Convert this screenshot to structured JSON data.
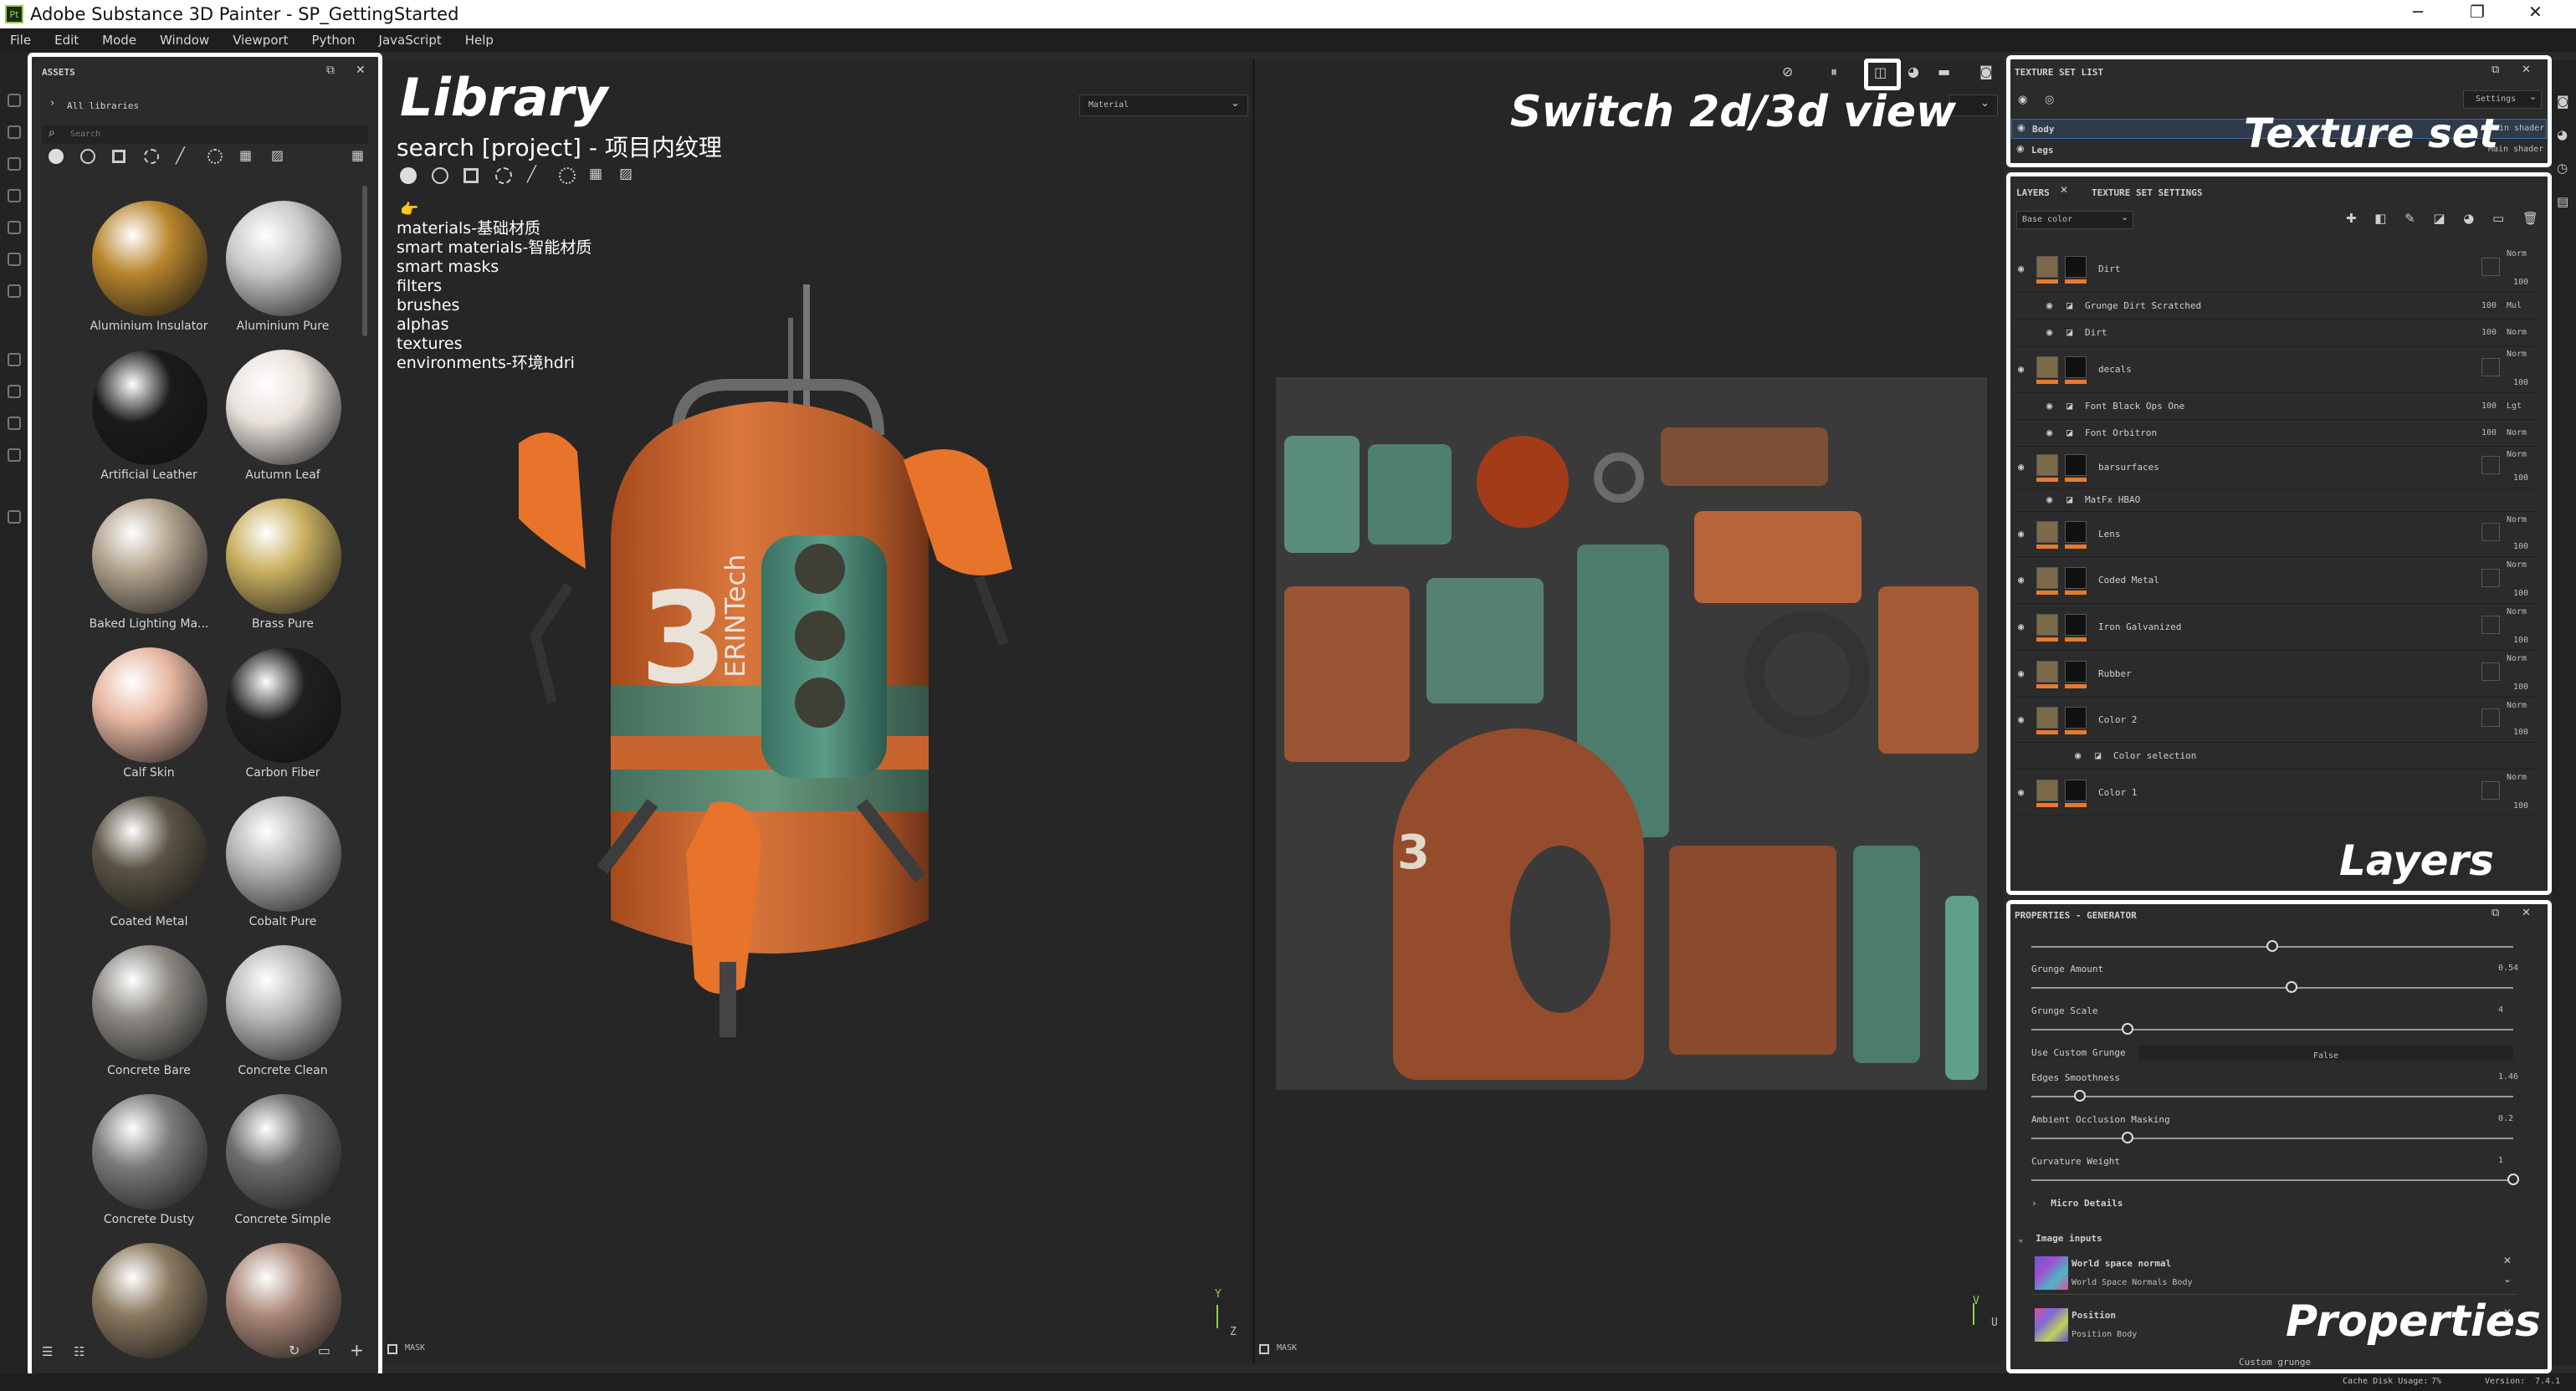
{
  "window": {
    "title": "Adobe Substance 3D Painter - SP_GettingStarted",
    "logo": "Pt",
    "minimize": "─",
    "maximize": "❐",
    "close": "✕"
  },
  "menu": [
    "File",
    "Edit",
    "Mode",
    "Window",
    "Viewport",
    "Python",
    "JavaScript",
    "Help"
  ],
  "assets": {
    "title": "ASSETS",
    "breadcrumb": "All libraries",
    "search_placeholder": "Search",
    "materials": [
      {
        "name": "Aluminium Insulator",
        "color": "#b8862d"
      },
      {
        "name": "Aluminium Pure",
        "color": "#c8c8c8"
      },
      {
        "name": "Artificial Leather",
        "color": "#1b1b1b"
      },
      {
        "name": "Autumn Leaf",
        "color": "#e9e2dc"
      },
      {
        "name": "Baked Lighting Ma...",
        "color": "#b3a48f"
      },
      {
        "name": "Brass Pure",
        "color": "#c9b060"
      },
      {
        "name": "Calf Skin",
        "color": "#e7b7a2"
      },
      {
        "name": "Carbon Fiber",
        "color": "#202020"
      },
      {
        "name": "Coated Metal",
        "color": "#5b5444"
      },
      {
        "name": "Cobalt Pure",
        "color": "#b5b5b5"
      },
      {
        "name": "Concrete Bare",
        "color": "#8d8a84"
      },
      {
        "name": "Concrete Clean",
        "color": "#b8b8b8"
      },
      {
        "name": "Concrete Dusty",
        "color": "#7b7b7b"
      },
      {
        "name": "Concrete Simple",
        "color": "#6d6d6d"
      },
      {
        "name": "",
        "color": "#8a7860"
      },
      {
        "name": "",
        "color": "#a98878"
      }
    ]
  },
  "library_note": {
    "heading": "Library",
    "search_line": "search [project] - 项目内纹理",
    "pointer": "👉",
    "items": [
      "materials-基础材质",
      "smart materials-智能材质",
      "smart masks",
      "filters",
      "brushes",
      "alphas",
      "textures",
      "environments-环境hdri"
    ]
  },
  "viewport": {
    "channel_select": "Material",
    "switch_label": "Switch 2d/3d view",
    "mask_left": "MASK",
    "mask_right": "MASK",
    "axis_y": "Y",
    "axis_z": "Z",
    "axis_u": "U",
    "axis_v": "V",
    "robot_number": "3",
    "robot_brand": "ERINTech",
    "uv_number": "3"
  },
  "texture_set_list": {
    "title": "TEXTURE SET LIST",
    "settings": "Settings",
    "items": [
      {
        "name": "Body",
        "shader": "Main shader"
      },
      {
        "name": "Legs",
        "shader": "Main shader"
      }
    ],
    "label": "Texture set"
  },
  "layers": {
    "tabs": [
      "LAYERS",
      "TEXTURE SET SETTINGS"
    ],
    "channel": "Base color",
    "label": "Layers",
    "rows": [
      {
        "name": "Dirt",
        "blend": "Norm",
        "opacity": "100",
        "level": 0
      },
      {
        "name": "Grunge Dirt Scratched",
        "blend": "Mul",
        "opacity": "100",
        "level": 1
      },
      {
        "name": "Dirt",
        "blend": "Norm",
        "opacity": "100",
        "level": 1
      },
      {
        "name": "decals",
        "blend": "Norm",
        "opacity": "100",
        "level": 0
      },
      {
        "name": "Font Black Ops One",
        "blend": "Lgt",
        "opacity": "100",
        "level": 1
      },
      {
        "name": "Font Orbitron",
        "blend": "Norm",
        "opacity": "100",
        "level": 1
      },
      {
        "name": "barsurfaces",
        "blend": "Norm",
        "opacity": "100",
        "level": 0
      },
      {
        "name": "MatFx HBAO",
        "blend": "",
        "opacity": "",
        "level": 1
      },
      {
        "name": "Lens",
        "blend": "Norm",
        "opacity": "100",
        "level": 0
      },
      {
        "name": "Coded Metal",
        "blend": "Norm",
        "opacity": "100",
        "level": 0
      },
      {
        "name": "Iron Galvanized",
        "blend": "Norm",
        "opacity": "100",
        "level": 0
      },
      {
        "name": "Rubber",
        "blend": "Norm",
        "opacity": "100",
        "level": 0
      },
      {
        "name": "Color 2",
        "blend": "Norm",
        "opacity": "100",
        "level": 0
      },
      {
        "name": "Color selection",
        "blend": "",
        "opacity": "",
        "level": 2
      },
      {
        "name": "Color 1",
        "blend": "Norm",
        "opacity": "100",
        "level": 0
      }
    ]
  },
  "properties": {
    "title": "PROPERTIES - GENERATOR",
    "label": "Properties",
    "params": [
      {
        "name": "Grunge Amount",
        "value": "0.54",
        "pos": 0.54
      },
      {
        "name": "Grunge Scale",
        "value": "4",
        "pos": 0.2
      },
      {
        "name": "Use Custom Grunge",
        "value": "False",
        "pos": null
      },
      {
        "name": "Edges Smoothness",
        "value": "1.46",
        "pos": 0.1
      },
      {
        "name": "Ambient Occlusion Masking",
        "value": "0.2",
        "pos": 0.2
      },
      {
        "name": "Curvature Weight",
        "value": "1",
        "pos": 1.0
      }
    ],
    "micro_details": "Micro Details",
    "image_inputs": "Image inputs",
    "inputs": [
      {
        "name": "World space normal",
        "value": "World Space Normals Body"
      },
      {
        "name": "Position",
        "value": "Position Body"
      }
    ],
    "custom_grunge": "Custom grunge"
  },
  "status": {
    "cache": "Cache Disk Usage:",
    "cache_value": "7%",
    "version": "Version:",
    "version_value": "7.4.1"
  }
}
